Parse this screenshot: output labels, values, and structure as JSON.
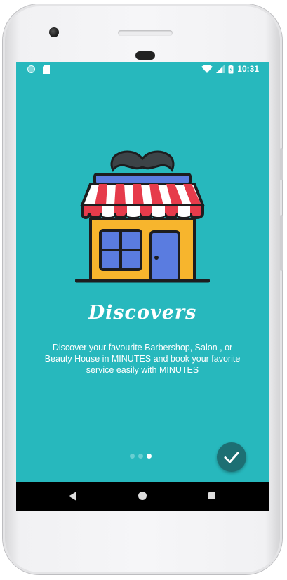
{
  "status_bar": {
    "time": "10:31"
  },
  "onboarding": {
    "title": "Discovers",
    "description": "Discover your favourite Barbershop, Salon , or Beauty House in MINUTES and book your favorite service easily with MINUTES",
    "page_indicator": {
      "total": 3,
      "current": 3
    }
  },
  "colors": {
    "background": "#27b8bd",
    "done_button": "#1d6f73"
  },
  "icons": [
    "barbershop-store-icon",
    "checkmark-icon",
    "wifi-icon",
    "signal-icon",
    "battery-icon",
    "back-icon",
    "home-icon",
    "recents-icon"
  ]
}
